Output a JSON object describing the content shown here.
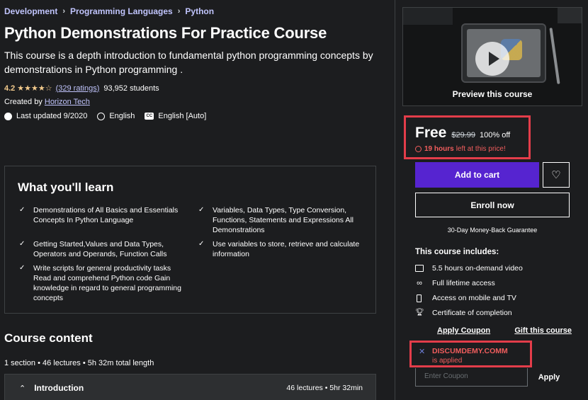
{
  "breadcrumb": [
    "Development",
    "Programming Languages",
    "Python"
  ],
  "course": {
    "title": "Python Demonstrations For Practice Course",
    "subtitle": "This course is a depth introduction to fundamental python programming concepts by demonstrations in Python programming .",
    "rating": "4.2",
    "stars": "★★★★☆",
    "ratings_count": "(329 ratings)",
    "students": "93,952 students",
    "created_by_label": "Created by",
    "instructor": "Horizon Tech",
    "last_updated": "Last updated 9/2020",
    "language": "English",
    "captions": "English [Auto]",
    "cc_icon_text": "CC"
  },
  "learn": {
    "title": "What you'll learn",
    "items": [
      "Demonstrations of All Basics and Essentials Concepts In Python Language",
      "Variables, Data Types, Type Conversion, Functions, Statements and Expressions All Demonstrations",
      "Getting Started,Values and Data Types, Operators and Operands, Function Calls",
      "Use variables to store, retrieve and calculate information",
      "Write scripts for general productivity tasks Read and comprehend Python code Gain knowledge in regard to general programming concepts"
    ]
  },
  "content": {
    "title": "Course content",
    "stats": "1 section • 46 lectures • 5h 32m total length",
    "sections": [
      {
        "name": "Introduction",
        "info": "46 lectures • 5hr 32min"
      }
    ]
  },
  "sidebar": {
    "preview_label": "Preview this course",
    "price": "Free",
    "original_price": "$29.99",
    "discount": "100% off",
    "timer_hours": "19 hours",
    "timer_suffix": "left at this price!",
    "add_to_cart": "Add to cart",
    "wishlist_icon": "♡",
    "enroll": "Enroll now",
    "guarantee": "30-Day Money-Back Guarantee",
    "includes_title": "This course includes:",
    "includes": [
      {
        "icon": "video-icon",
        "text": "5.5 hours on-demand video"
      },
      {
        "icon": "infinity-icon",
        "text": "Full lifetime access"
      },
      {
        "icon": "mobile-icon",
        "text": "Access on mobile and TV"
      },
      {
        "icon": "trophy-icon",
        "text": "Certificate of completion"
      }
    ],
    "apply_coupon": "Apply Coupon",
    "gift": "Gift this course",
    "coupon_code": "DISCUMDEMY.COMM",
    "coupon_status": "is applied",
    "coupon_placeholder": "Enter Coupon",
    "apply": "Apply"
  },
  "colors": {
    "background": "#1c1d1f",
    "accent_purple": "#5624d0",
    "link": "#c0c4fc",
    "star": "#f3ca8c",
    "highlight_red": "#e33d4a",
    "timer_red": "#f15d5d"
  }
}
